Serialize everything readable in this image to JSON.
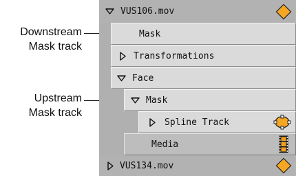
{
  "annotations": {
    "downstream_line1": "Downstream",
    "downstream_line2": "Mask track",
    "upstream_line1": "Upstream",
    "upstream_line2": "Mask track"
  },
  "tracks": {
    "movie1": {
      "label": "VUS106.mov",
      "expanded": true,
      "icon": "diamond-icon"
    },
    "mask_downstream": {
      "label": "Mask"
    },
    "transformations": {
      "label": "Transformations",
      "expanded": false
    },
    "face": {
      "label": "Face",
      "expanded": true
    },
    "mask_upstream": {
      "label": "Mask",
      "expanded": true
    },
    "spline_track": {
      "label": "Spline Track",
      "expanded": false,
      "icon": "spline-node-icon"
    },
    "media": {
      "label": "Media",
      "icon": "film-strip-icon"
    },
    "movie2": {
      "label": "VUS134.mov",
      "expanded": false,
      "icon": "diamond-icon"
    }
  },
  "colors": {
    "diamond_fill": "#f5a623",
    "spline_fill": "#f5a623",
    "film_fill": "#f0a020"
  }
}
